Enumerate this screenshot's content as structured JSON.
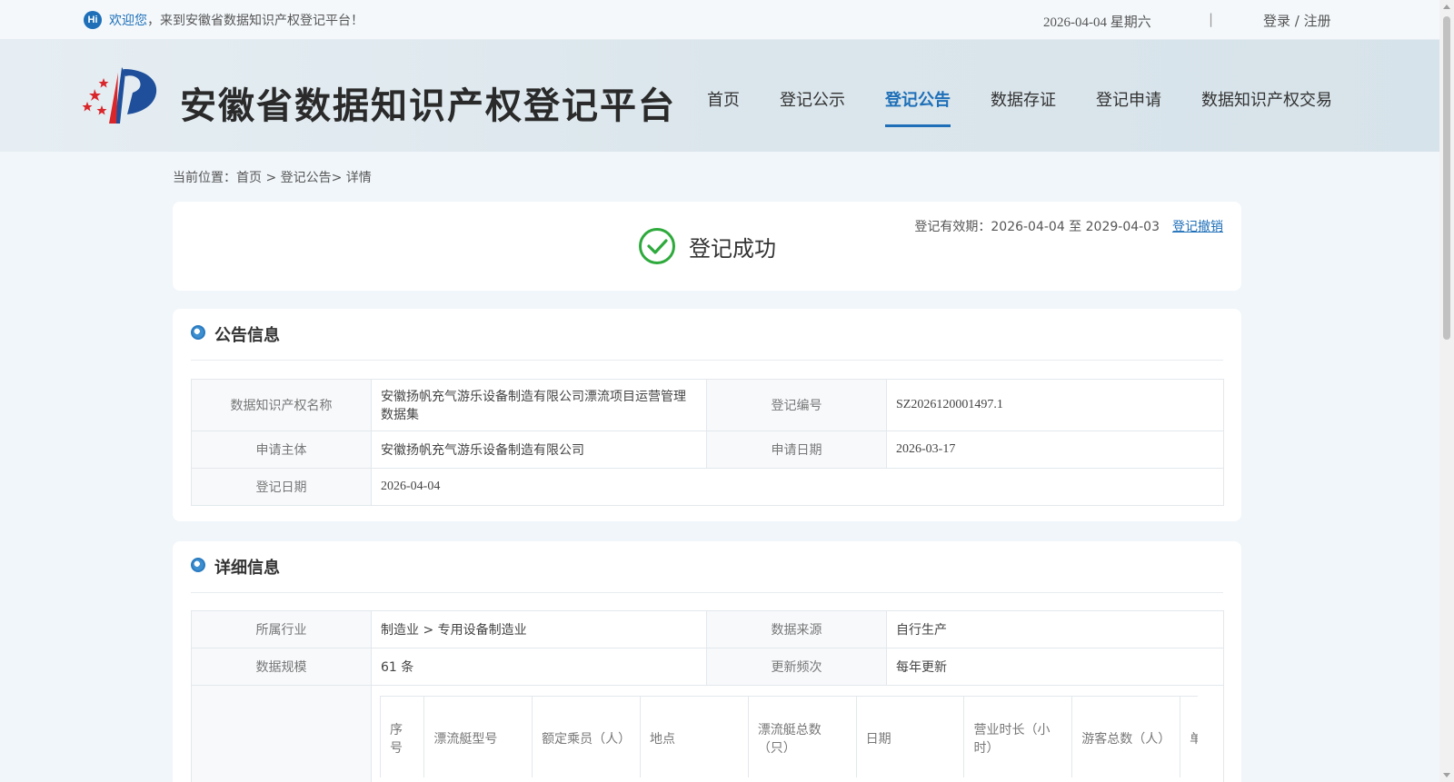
{
  "topbar": {
    "hi": "Hi",
    "welcome_highlight": "欢迎您",
    "welcome_rest": "，来到安徽省数据知识产权登记平台！",
    "date": "2026-04-04 星期六",
    "separator": "|",
    "login": "登录 / 注册"
  },
  "header": {
    "site_title": "安徽省数据知识产权登记平台",
    "nav": [
      "首页",
      "登记公示",
      "登记公告",
      "数据存证",
      "登记申请",
      "数据知识产权交易"
    ],
    "active_nav": "登记公告"
  },
  "breadcrumb": "当前位置：首页 > 登记公告> 详情",
  "status": {
    "validity": "登记有效期：2026-04-04 至 2029-04-03",
    "revoke": "登记撤销",
    "success_text": "登记成功"
  },
  "notice": {
    "title": "公告信息",
    "labels": {
      "name": "数据知识产权名称",
      "reg_no": "登记编号",
      "applicant": "申请主体",
      "apply_date": "申请日期",
      "reg_date": "登记日期"
    },
    "values": {
      "name": "安徽扬帆充气游乐设备制造有限公司漂流项目运营管理数据集",
      "reg_no": "SZ2026120001497.1",
      "applicant": "安徽扬帆充气游乐设备制造有限公司",
      "apply_date": "2026-03-17",
      "reg_date": "2026-04-04"
    }
  },
  "detail": {
    "title": "详细信息",
    "labels": {
      "industry": "所属行业",
      "source": "数据来源",
      "scale": "数据规模",
      "frequency": "更新频次"
    },
    "values": {
      "industry": "制造业 > 专用设备制造业",
      "source": "自行生产",
      "scale": "61 条",
      "frequency": "每年更新"
    },
    "columns": [
      "序号",
      "漂流艇型号",
      "额定乘员（人）",
      "地点",
      "漂流艇总数（只）",
      "日期",
      "营业时长（小时）",
      "游客总数（人）",
      "单次（人）"
    ]
  }
}
